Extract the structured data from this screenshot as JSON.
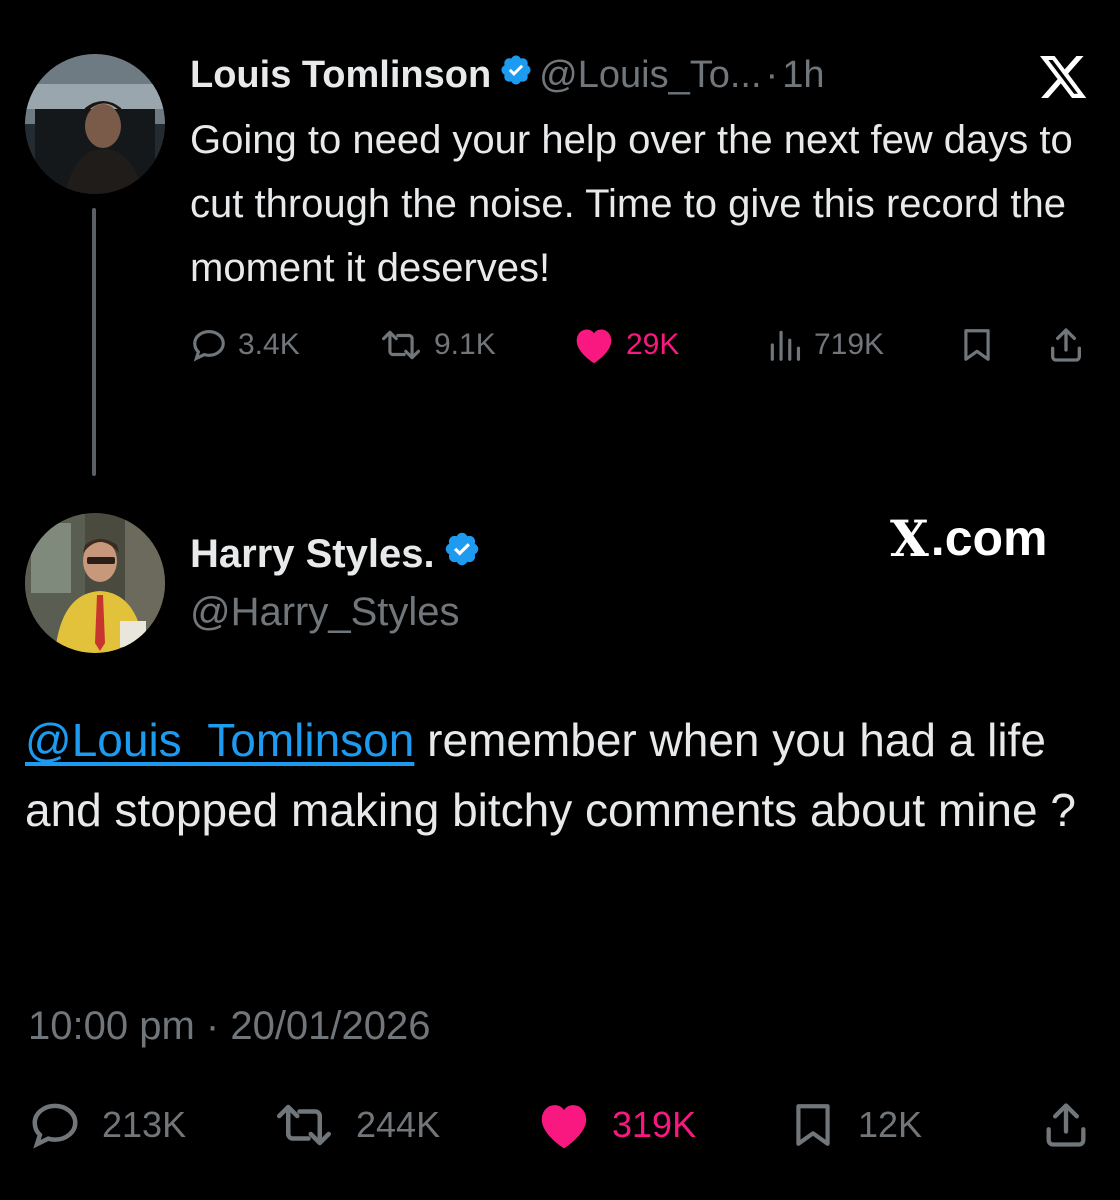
{
  "parent_tweet": {
    "display_name": "Louis Tomlinson",
    "handle": "@Louis_To...",
    "separator": "·",
    "time": "1h",
    "text": "Going to need your help over the next few days to cut through the noise. Time to give this record the moment it deserves!",
    "stats": {
      "replies": "3.4K",
      "reposts": "9.1K",
      "likes": "29K",
      "views": "719K"
    },
    "verified": true
  },
  "reply_tweet": {
    "display_name": "Harry Styles.",
    "handle": "@Harry_Styles",
    "verified": true,
    "mention": "@Louis_Tomlinson",
    "text": " remember when you had a life and stopped making bitchy comments about mine ?",
    "timestamp": "10:00 pm · 20/01/2026",
    "stats": {
      "replies": "213K",
      "reposts": "244K",
      "likes": "319K",
      "bookmarks": "12K"
    }
  },
  "watermark": {
    "x_glyph": "X",
    "suffix": ".com"
  },
  "colors": {
    "background": "#000000",
    "text_primary": "#e7e9ea",
    "text_secondary": "#71767b",
    "like_pink": "#f91880",
    "verified_blue": "#1d9bf0",
    "mention_blue": "#1d9bf0"
  },
  "icons": {
    "reply": "reply-icon",
    "repost": "repost-icon",
    "like": "heart-icon",
    "views": "views-icon",
    "bookmark": "bookmark-icon",
    "share": "share-icon",
    "verified": "verified-badge-icon",
    "brand": "x-logo-icon"
  }
}
